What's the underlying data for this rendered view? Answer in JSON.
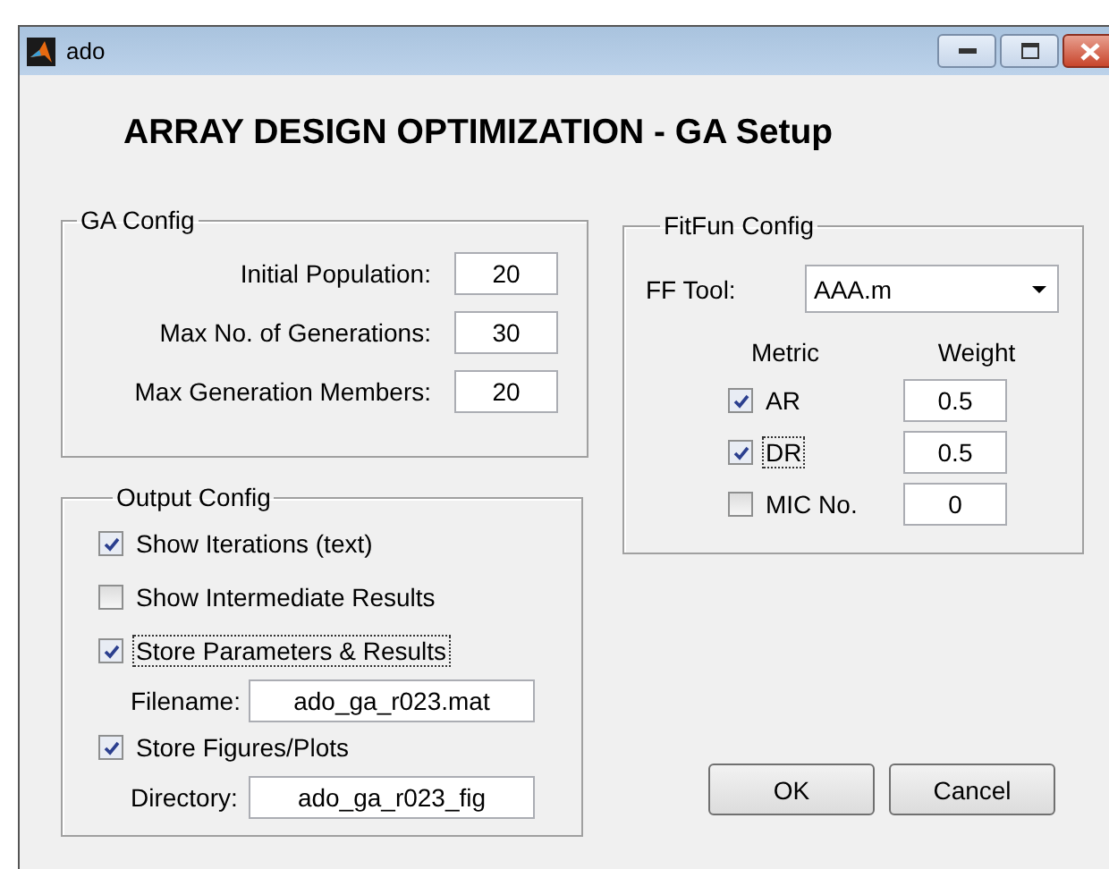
{
  "window": {
    "title": "ado"
  },
  "heading": "ARRAY DESIGN OPTIMIZATION - GA Setup",
  "ga_config": {
    "title": "GA Config",
    "fields": [
      {
        "label": "Initial Population:",
        "value": "20"
      },
      {
        "label": "Max No. of Generations:",
        "value": "30"
      },
      {
        "label": "Max Generation Members:",
        "value": "20"
      }
    ]
  },
  "output_config": {
    "title": "Output Config",
    "options": [
      {
        "kind": "checkbox",
        "label": "Show Iterations (text)",
        "checked": true,
        "focused": false
      },
      {
        "kind": "checkbox",
        "label": "Show Intermediate Results",
        "checked": false,
        "focused": false
      },
      {
        "kind": "checkbox",
        "label": "Store Parameters & Results",
        "checked": true,
        "focused": true
      },
      {
        "kind": "field",
        "label": "Filename:",
        "value": "ado_ga_r023.mat"
      },
      {
        "kind": "checkbox",
        "label": "Store Figures/Plots",
        "checked": true,
        "focused": false
      },
      {
        "kind": "field",
        "label": "Directory:",
        "value": "ado_ga_r023_fig"
      }
    ]
  },
  "fitfun_config": {
    "title": "FitFun Config",
    "tool": {
      "label": "FF Tool:",
      "value": "AAA.m"
    },
    "headers": {
      "metric": "Metric",
      "weight": "Weight"
    },
    "metrics": [
      {
        "label": "AR",
        "checked": true,
        "focused": false,
        "weight": "0.5"
      },
      {
        "label": "DR",
        "checked": true,
        "focused": true,
        "weight": "0.5"
      },
      {
        "label": "MIC No.",
        "checked": false,
        "focused": false,
        "weight": "0"
      }
    ]
  },
  "buttons": [
    {
      "label": "OK"
    },
    {
      "label": "Cancel"
    }
  ]
}
